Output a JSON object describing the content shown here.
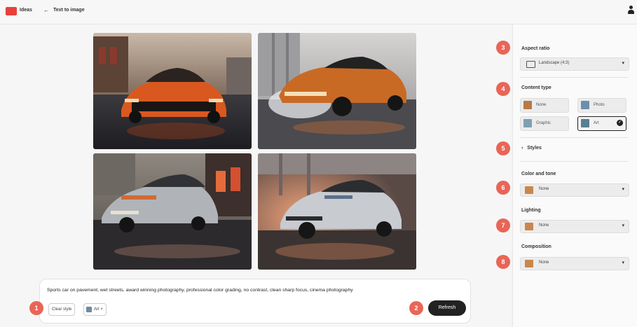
{
  "topbar": {
    "logo_text": "Ideas",
    "back_arrow": "←",
    "page_title": "Text to image",
    "user_icon": "user-icon"
  },
  "images": [
    {
      "alt": "Orange sports car on wet street"
    },
    {
      "alt": "Orange sports car splashing water"
    },
    {
      "alt": "Silver sports car with orange accents"
    },
    {
      "alt": "Silver sports car drifting"
    }
  ],
  "prompt": {
    "text": "Sports car on pavement, wet streets, award winning photography, professional color grading, no contrast, clean sharp focus, cinema photography",
    "style_chip": "Clear style",
    "art_chip": "Art ×",
    "refresh_label": "Refresh"
  },
  "panel": {
    "aspect_ratio": {
      "title": "Aspect ratio",
      "value": "Landscape (4:3)"
    },
    "content_type": {
      "title": "Content type",
      "options": [
        {
          "label": "None",
          "thumb_color": "#b87945"
        },
        {
          "label": "Photo",
          "thumb_color": "#6d8fa9"
        },
        {
          "label": "Graphic",
          "thumb_color": "#7fa0b4"
        },
        {
          "label": "Art",
          "thumb_color": "#5a7f92",
          "selected": true
        }
      ]
    },
    "styles": {
      "title": "Styles",
      "chevron": "›"
    },
    "color_tone": {
      "title": "Color and tone",
      "value": "None"
    },
    "lighting": {
      "title": "Lighting",
      "value": "None"
    },
    "composition": {
      "title": "Composition",
      "value": "None"
    }
  },
  "callouts": [
    "1",
    "2",
    "3",
    "4",
    "5",
    "6",
    "7",
    "8"
  ],
  "colors": {
    "accent": "#e74c3c",
    "dark_button": "#222222"
  }
}
